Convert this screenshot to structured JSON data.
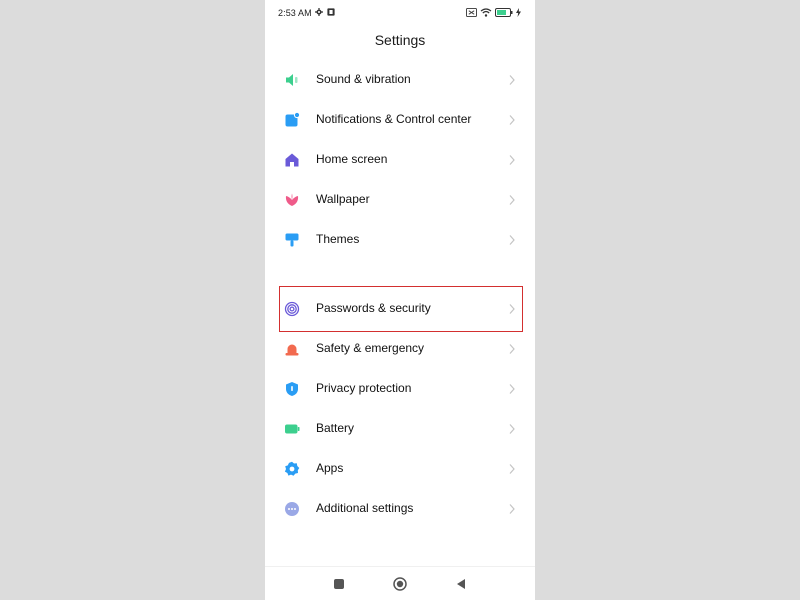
{
  "status_bar": {
    "time": "2:53 AM",
    "left_icons": [
      "gear-icon",
      "notification-square-icon"
    ],
    "right_icons": [
      "sim-icon",
      "wifi-icon",
      "battery-icon",
      "charging-icon"
    ]
  },
  "header": {
    "title": "Settings"
  },
  "settings": {
    "items": [
      {
        "label": "Sound & vibration",
        "icon": "speaker-icon",
        "color": "#3ccf8e"
      },
      {
        "label": "Notifications & Control center",
        "icon": "notification-icon",
        "color": "#2a9df4"
      },
      {
        "label": "Home screen",
        "icon": "home-icon",
        "color": "#6a5ad8"
      },
      {
        "label": "Wallpaper",
        "icon": "wallpaper-flower-icon",
        "color": "#ef5b8a"
      },
      {
        "label": "Themes",
        "icon": "themes-brush-icon",
        "color": "#2a9df4"
      },
      {
        "label": "Passwords & security",
        "icon": "fingerprint-icon",
        "color": "#6a5ad8"
      },
      {
        "label": "Safety & emergency",
        "icon": "siren-icon",
        "color": "#f26a4f"
      },
      {
        "label": "Privacy protection",
        "icon": "privacy-shield-icon",
        "color": "#2a9df4"
      },
      {
        "label": "Battery",
        "icon": "battery-icon",
        "color": "#3ccf8e"
      },
      {
        "label": "Apps",
        "icon": "apps-gear-icon",
        "color": "#2a9df4"
      },
      {
        "label": "Additional settings",
        "icon": "more-dots-icon",
        "color": "#9aa8e6"
      }
    ]
  },
  "highlight": {
    "target": "Passwords & security",
    "color": "#d32f2f"
  },
  "nav_bar": {
    "buttons": [
      "recents-square-icon",
      "home-circle-icon",
      "back-triangle-icon"
    ]
  }
}
